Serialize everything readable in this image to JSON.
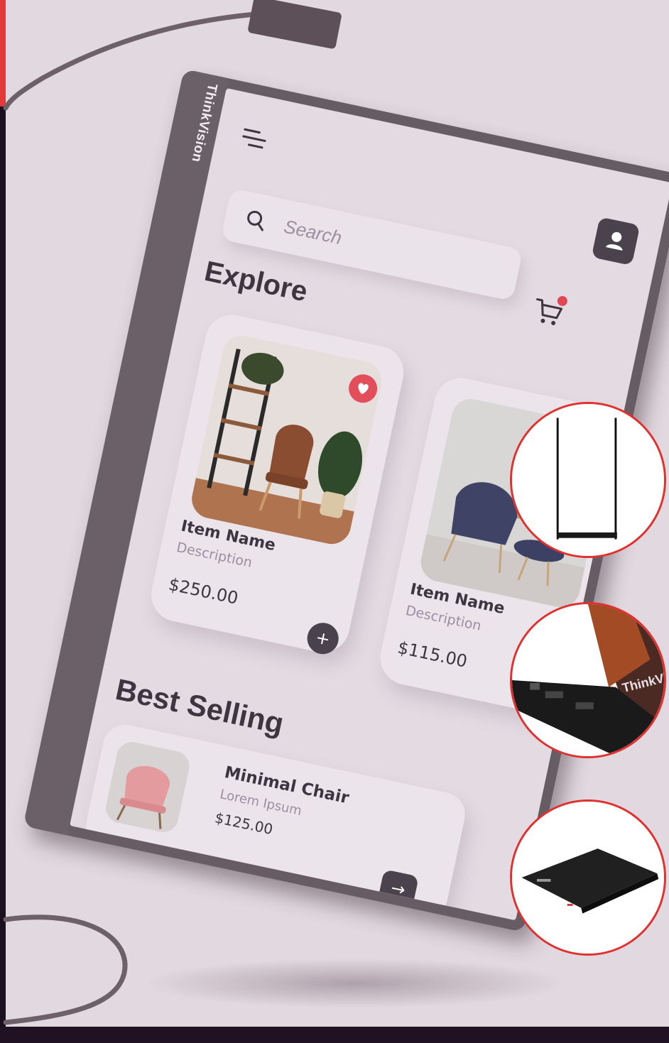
{
  "monitor": {
    "brand": "ThinkVision"
  },
  "header": {
    "menu_icon": "hamburger-menu-icon",
    "profile_icon": "user-icon"
  },
  "search": {
    "placeholder": "Search",
    "icon": "search-icon"
  },
  "cart": {
    "icon": "cart-icon",
    "has_notification": true
  },
  "explore": {
    "title": "Explore",
    "items": [
      {
        "name": "Item Name",
        "description": "Description",
        "price": "$250.00",
        "favorited": true
      },
      {
        "name": "Item Name",
        "description": "Description",
        "price": "$115.00",
        "favorited": false
      }
    ]
  },
  "best_selling": {
    "title": "Best Selling",
    "items": [
      {
        "name": "Minimal Chair",
        "description": "Lorem Ipsum",
        "price": "$125.00"
      }
    ]
  },
  "thumbnails": {
    "items": [
      {
        "label": "monitor-side-profile"
      },
      {
        "label": "monitor-ports-closeup",
        "brand": "ThinkVision"
      },
      {
        "label": "monitor-folded-stand"
      }
    ]
  },
  "colors": {
    "background": "#e2d8df",
    "accent": "#e24f5b",
    "dark": "#4a424c",
    "thumb_border": "#e0312f"
  }
}
